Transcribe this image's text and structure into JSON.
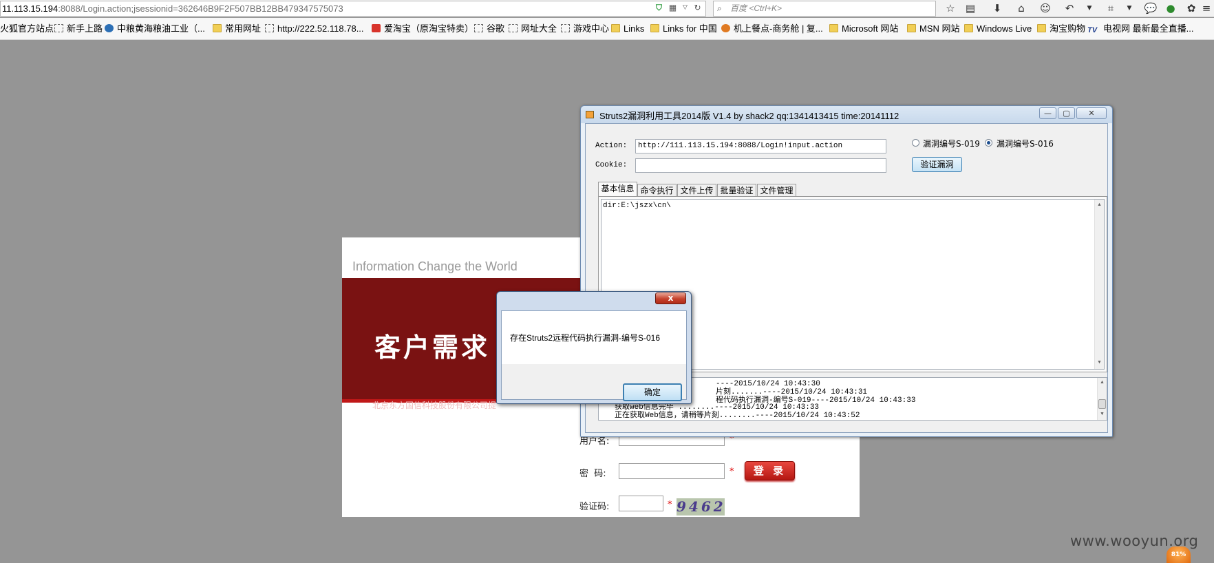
{
  "browser": {
    "url_host": "11.113.15.194",
    "url_rest": ":8088/Login.action;jsessionid=362646B9F2F507BB12BB479347575073",
    "search_placeholder": "百度 <Ctrl+K>",
    "bookmarks": [
      {
        "label": "火狐官方站点",
        "icon": "none"
      },
      {
        "label": "新手上路",
        "icon": "page"
      },
      {
        "label": "中粮黄海粮油工业（...",
        "icon": "blue"
      },
      {
        "label": "常用网址",
        "icon": "folder"
      },
      {
        "label": "http://222.52.118.78...",
        "icon": "page"
      },
      {
        "label": "爱淘宝（原淘宝特卖）",
        "icon": "red"
      },
      {
        "label": "谷歌",
        "icon": "page"
      },
      {
        "label": "网址大全",
        "icon": "page"
      },
      {
        "label": "游戏中心",
        "icon": "page"
      },
      {
        "label": "Links",
        "icon": "folder"
      },
      {
        "label": "Links for 中国",
        "icon": "folder"
      },
      {
        "label": "机上餐点-商务舱 | 复...",
        "icon": "orange"
      },
      {
        "label": "Microsoft 网站",
        "icon": "folder"
      },
      {
        "label": "MSN 网站",
        "icon": "folder"
      },
      {
        "label": "Windows Live",
        "icon": "folder"
      },
      {
        "label": "淘宝购物",
        "icon": "folder"
      },
      {
        "label": "电视网 最新最全直播...",
        "icon": "tv"
      }
    ]
  },
  "login_page": {
    "slogan": "Information Change the World",
    "banner_title": "客户需求",
    "banner_company": "北京东方国信科技股份有限公司提",
    "username_label": "用户名:",
    "password_label": "密  码:",
    "captcha_label": "验证码:",
    "required_mark": "*",
    "login_button": "登 录",
    "captcha_text": "9462"
  },
  "tool": {
    "title": "Struts2漏洞利用工具2014版 V1.4 by shack2 qq:1341413415 time:20141112",
    "action_label": "Action:",
    "action_value": "http://111.113.15.194:8088/Login!input.action",
    "cookie_label": "Cookie:",
    "cookie_value": "",
    "radio_s019": "漏洞编号S-019",
    "radio_s016": "漏洞编号S-016",
    "selected_radio": "S-016",
    "verify_button": "验证漏洞",
    "tabs": [
      "基本信息",
      "命令执行",
      "文件上传",
      "批量验证",
      "文件管理"
    ],
    "active_tab": 0,
    "output_text": "dir:E:\\jszx\\cn\\",
    "log_lines": [
      "----2015/10/24 10:43:30",
      "片刻.......----2015/10/24 10:43:31",
      "程代码执行漏洞-编号S-019----2015/10/24 10:43:33",
      "获取web信息完毕 ........----2015/10/24 10:43:33",
      "正在获取Web信息，请稍等片刻........----2015/10/24 10:43:52"
    ]
  },
  "msgbox": {
    "message": "存在Struts2远程代码执行漏洞-编号S-016",
    "ok_label": "确定",
    "close_glyph": "x"
  },
  "watermark": "www.wooyun.org",
  "tray_badge": "81%"
}
